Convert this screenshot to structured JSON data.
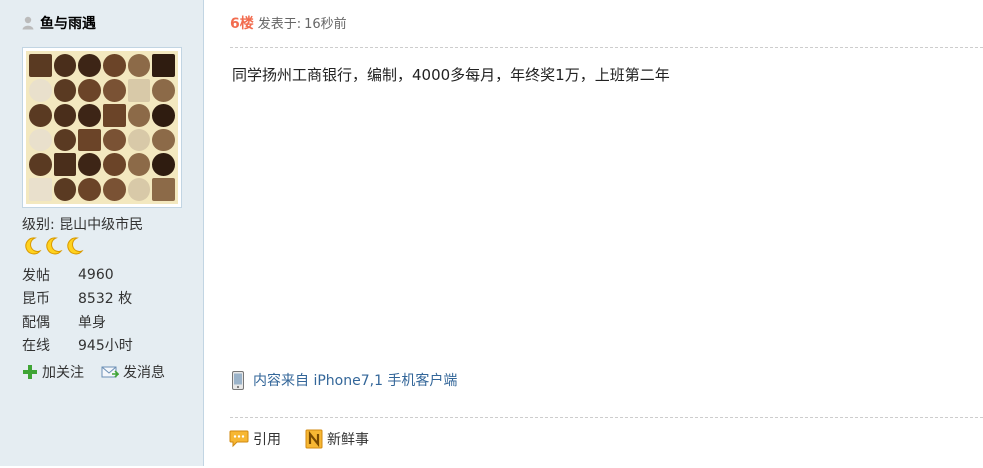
{
  "user": {
    "name": "鱼与雨遇",
    "level_label": "级别: 昆山中级市民",
    "moon_count": 3,
    "stats": [
      {
        "label": "发帖",
        "value": "4960"
      },
      {
        "label": "昆币",
        "value": "8532 枚"
      },
      {
        "label": "配偶",
        "value": "单身"
      },
      {
        "label": "在线",
        "value": "945小时"
      }
    ],
    "actions": {
      "follow": "加关注",
      "message": "发消息"
    }
  },
  "post": {
    "floor": "6楼",
    "time_label": "发表于:",
    "time_value": "16秒前",
    "content": "同学扬州工商银行，编制，4000多每月，年终奖1万，上班第二年",
    "source": "内容来自 iPhone7,1 手机客户端",
    "actions": {
      "quote": "引用",
      "news": "新鲜事"
    }
  },
  "colors": {
    "sidebar_bg": "#e5edf2",
    "floor": "#f26c4f",
    "link": "#336699"
  },
  "icons": [
    "user-icon",
    "moon-icon",
    "plus-icon",
    "mail-icon",
    "phone-icon",
    "quote-icon",
    "news-icon"
  ]
}
